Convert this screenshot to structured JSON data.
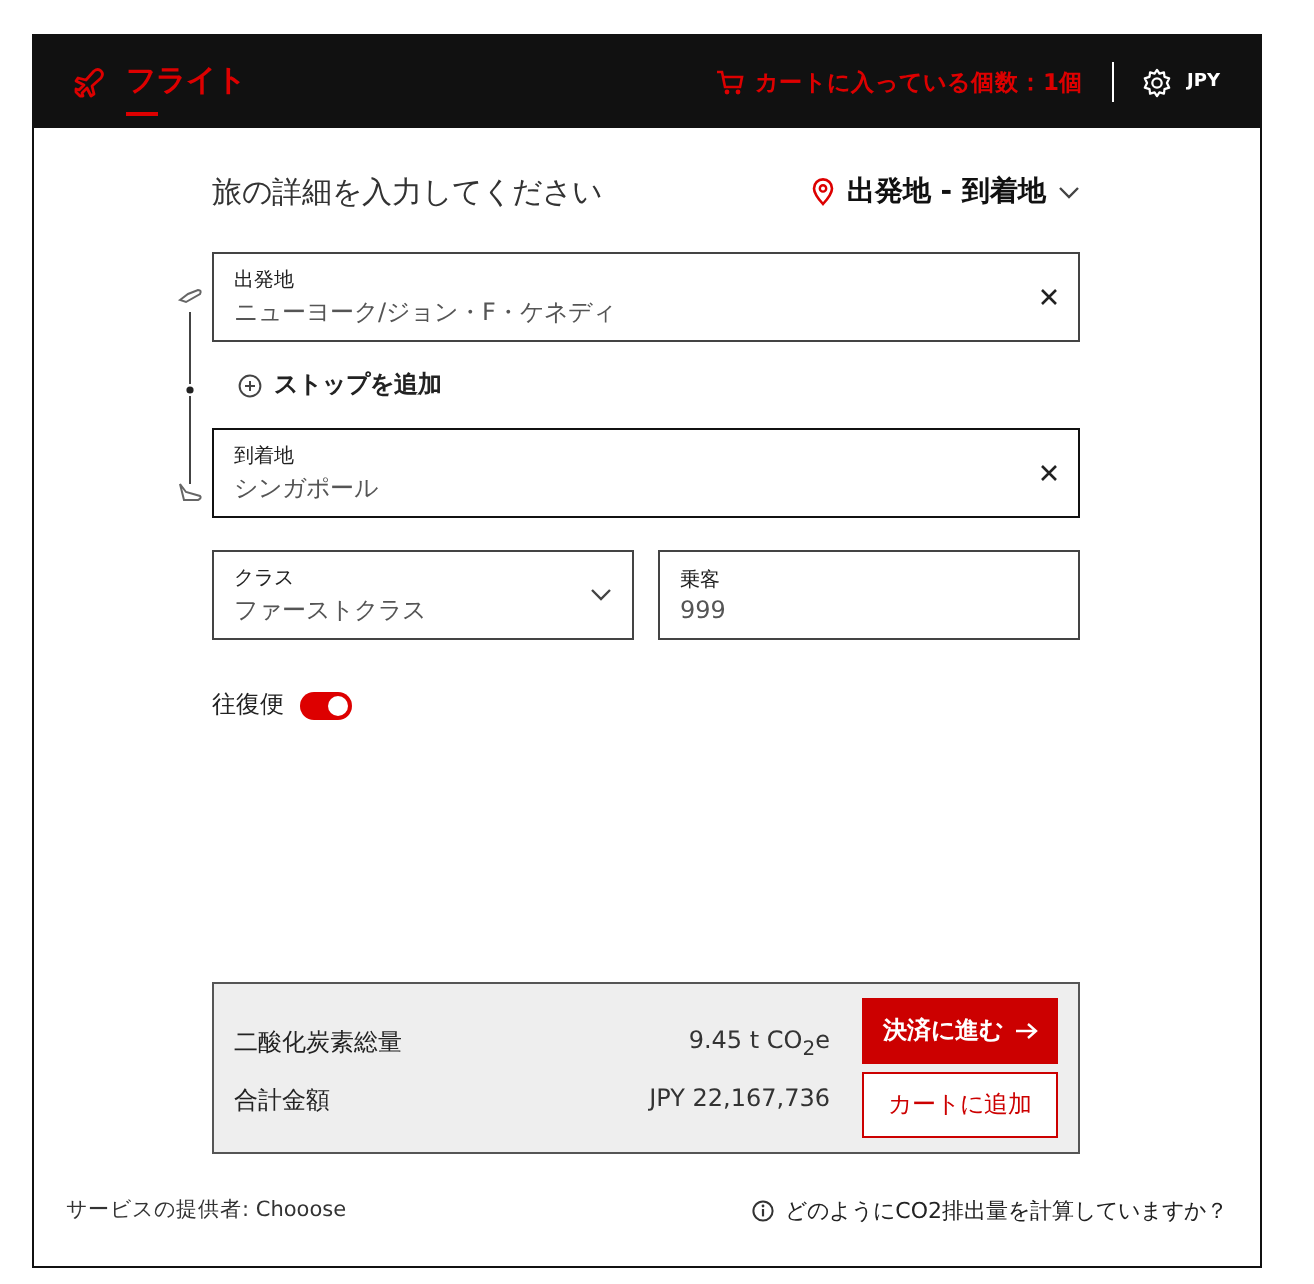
{
  "header": {
    "tab": {
      "label": "フライト",
      "selected": true
    },
    "cart": "カートに入っている個数：1個",
    "currency": "JPY"
  },
  "form": {
    "title": "旅の詳細を入力してください",
    "mode": "出発地 - 到着地",
    "origin": {
      "label": "出発地",
      "value": "ニューヨーク/ジョン・F・ケネディ"
    },
    "add_stop": "ストップを追加",
    "destination": {
      "label": "到着地",
      "value": "シンガポール"
    },
    "cabin": {
      "label": "クラス",
      "value": "ファーストクラス"
    },
    "passengers": {
      "label": "乗客",
      "value": "999"
    },
    "round_trip": {
      "label": "往復便",
      "on": true
    }
  },
  "summary": {
    "rows": [
      {
        "label": "二酸化炭素総量",
        "value": "9.45 t CO$_{2}$e"
      },
      {
        "label": "合計金額",
        "value": "JPY 22,167,736"
      }
    ],
    "checkout": "決済に進む",
    "add_to_cart": "カートに追加"
  },
  "footer": {
    "provider": "サービスの提供者: Chooose",
    "help": "どのようにCO2排出量を計算していますか？"
  }
}
